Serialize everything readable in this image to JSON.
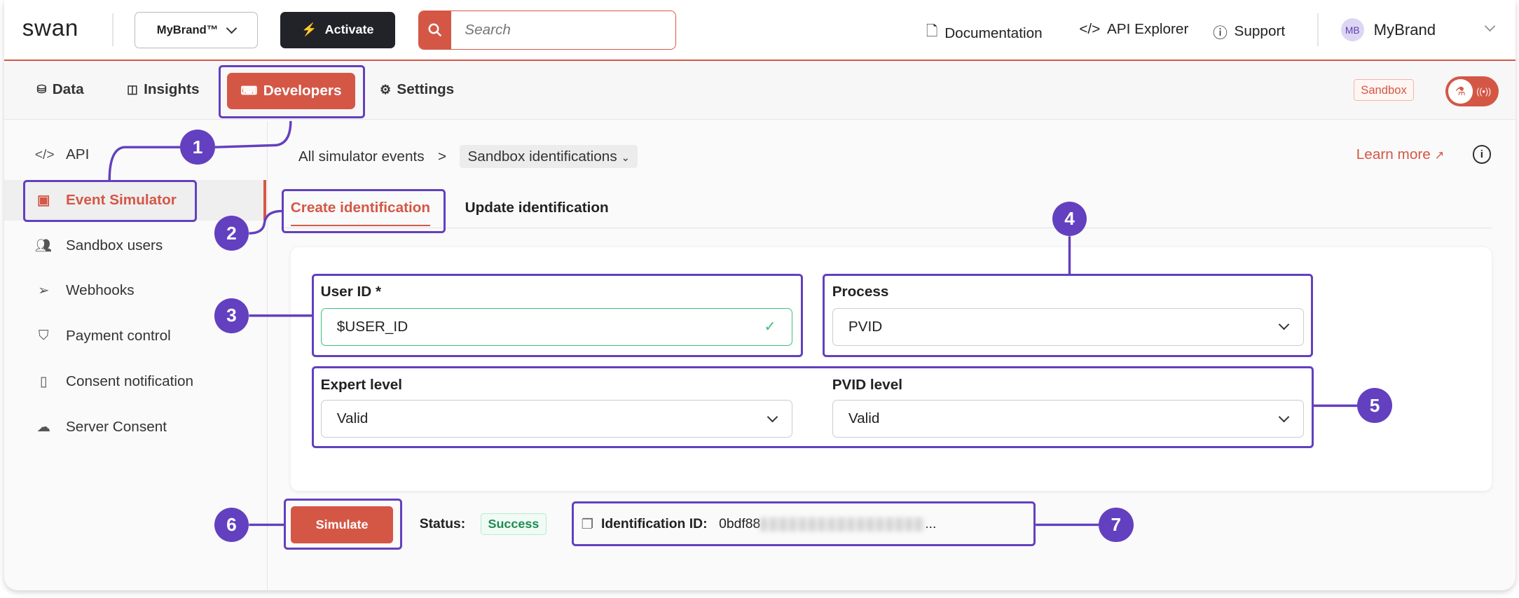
{
  "header": {
    "logo": "swan",
    "brand_select": "MyBrand™",
    "activate": "Activate",
    "search_placeholder": "Search",
    "links": [
      "Documentation",
      "API Explorer",
      "Support"
    ],
    "user": {
      "initials": "MB",
      "name": "MyBrand"
    }
  },
  "nav": {
    "items": [
      "Data",
      "Insights",
      "Developers",
      "Settings"
    ],
    "active": "Developers",
    "env_badge": "Sandbox"
  },
  "sidebar": {
    "items": [
      {
        "label": "API",
        "icon": "code-icon"
      },
      {
        "label": "Event Simulator",
        "icon": "simulator-icon"
      },
      {
        "label": "Sandbox users",
        "icon": "users-icon"
      },
      {
        "label": "Webhooks",
        "icon": "send-icon"
      },
      {
        "label": "Payment control",
        "icon": "shield-icon"
      },
      {
        "label": "Consent notification",
        "icon": "phone-icon"
      },
      {
        "label": "Server Consent",
        "icon": "cloud-icon"
      }
    ],
    "active": "Event Simulator"
  },
  "breadcrumb": {
    "parent": "All simulator events",
    "separator": ">",
    "current": "Sandbox identifications"
  },
  "learn_more": "Learn more",
  "tabs": [
    "Create identification",
    "Update identification"
  ],
  "form": {
    "user_id": {
      "label": "User ID *",
      "value": "$USER_ID"
    },
    "process": {
      "label": "Process",
      "value": "PVID"
    },
    "expert_level": {
      "label": "Expert level",
      "value": "Valid"
    },
    "pvid_level": {
      "label": "PVID level",
      "value": "Valid"
    }
  },
  "actions": {
    "simulate": "Simulate",
    "status_label": "Status:",
    "status_value": "Success",
    "id_label": "Identification ID:",
    "id_value": "0bdf88",
    "id_ellipsis": "..."
  },
  "annotations": [
    "1",
    "2",
    "3",
    "4",
    "5",
    "6",
    "7"
  ],
  "colors": {
    "accent": "#d45746",
    "annotation": "#6340bf",
    "success": "#1f8a52"
  }
}
